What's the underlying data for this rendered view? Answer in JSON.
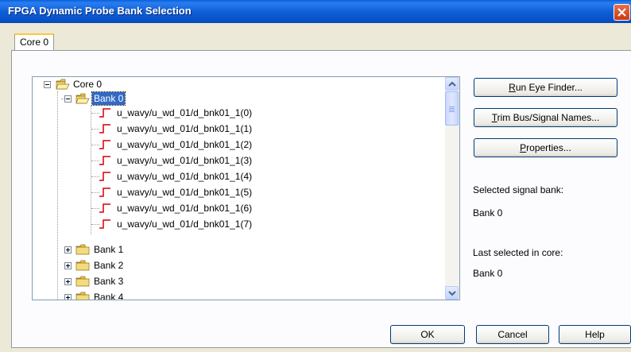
{
  "window": {
    "title": "FPGA Dynamic Probe Bank Selection"
  },
  "tabs": [
    {
      "label": "Core 0"
    }
  ],
  "tree": {
    "root": "Core 0",
    "bank0": {
      "label": "Bank  0",
      "signals": [
        "u_wavy/u_wd_01/d_bnk01_1(0)",
        "u_wavy/u_wd_01/d_bnk01_1(1)",
        "u_wavy/u_wd_01/d_bnk01_1(2)",
        "u_wavy/u_wd_01/d_bnk01_1(3)",
        "u_wavy/u_wd_01/d_bnk01_1(4)",
        "u_wavy/u_wd_01/d_bnk01_1(5)",
        "u_wavy/u_wd_01/d_bnk01_1(6)",
        "u_wavy/u_wd_01/d_bnk01_1(7)"
      ]
    },
    "other_banks": [
      "Bank  1",
      "Bank  2",
      "Bank  3",
      "Bank  4"
    ]
  },
  "buttons": {
    "run_eye_finder": {
      "mnemonic": "R",
      "rest": "un Eye Finder..."
    },
    "trim_names": {
      "mnemonic": "T",
      "rest": "rim Bus/Signal Names..."
    },
    "properties": {
      "mnemonic": "P",
      "rest": "roperties..."
    },
    "ok": "OK",
    "cancel": "Cancel",
    "help": "Help"
  },
  "info": {
    "selected_label": "Selected signal bank:",
    "selected_value": "Bank  0",
    "last_label": "Last selected in core:",
    "last_value": "Bank  0"
  },
  "colors": {
    "title_bar": "#0A5FD8",
    "selection": "#316AC5",
    "signal_icon": "#D40000"
  }
}
